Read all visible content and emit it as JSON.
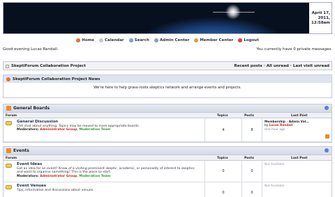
{
  "header": {
    "date_line1": "April 17,",
    "date_line2": "2011,",
    "date_line3": "12:58am"
  },
  "nav": [
    {
      "label": "Home",
      "icon": "home-icon",
      "color": "#d9782a"
    },
    {
      "label": "Calendar",
      "icon": "calendar-icon",
      "color": "#c8c8c8"
    },
    {
      "label": "Search",
      "icon": "search-icon",
      "color": "#7aa0d8"
    },
    {
      "label": "Admin Center",
      "icon": "admin-icon",
      "color": "#88a0b8"
    },
    {
      "label": "Member Center",
      "icon": "member-icon",
      "color": "#d8a040"
    },
    {
      "label": "Logout",
      "icon": "logout-icon",
      "color": "#d84040"
    }
  ],
  "greeting": {
    "text": "Good evening Lucas Randall.",
    "messages": "You currently have 0 private messages."
  },
  "project_bar": {
    "title": "SkeptiForum Collaboration Project",
    "recent": "Recent posts",
    "sep1": "·",
    "all_unread": "All unread",
    "sep2": "·",
    "last_visit": "Last visit unread"
  },
  "news": {
    "title": "SkeptiForum Collaboration Project News",
    "body": "We're here to help grass-roots skeptics network and arrange events and projects."
  },
  "columns": {
    "forum": "Forum",
    "topics": "Topics",
    "posts": "Posts",
    "last_post": "Last Post"
  },
  "categories": [
    {
      "title": "General Boards",
      "forums": [
        {
          "title": "General Discussion",
          "desc": "Chit chat about anything. Topics may be moved to more appropriate boards.",
          "mods_label": "Moderators:",
          "mod1": "Administrator Group",
          "mod_sep": ",",
          "mod2": "Moderation Team",
          "topics": "4",
          "posts": "8",
          "last_title": "Membership - Admin Val...",
          "last_by_label": "by",
          "last_by": "Lucas Randall",
          "last_when": "One hour ago"
        }
      ]
    },
    {
      "title": "Events",
      "forums": [
        {
          "title": "Event Ideas",
          "desc": "Got an idea for an event? Know of a visiting prominent skeptic, academic, or personality of interest to skeptics and want to organise something? This is the place to start.",
          "mods_label": "Moderators:",
          "mod1": "Administrator Group",
          "mod_sep": ",",
          "mod2": "Moderation Team",
          "topics": "0",
          "posts": "0",
          "last_na": "Not Available"
        },
        {
          "title": "Event Venues",
          "desc": "Tips, information and discussions about venues.",
          "topics": "0",
          "posts": "0",
          "last_na": "Not Available"
        }
      ]
    }
  ]
}
